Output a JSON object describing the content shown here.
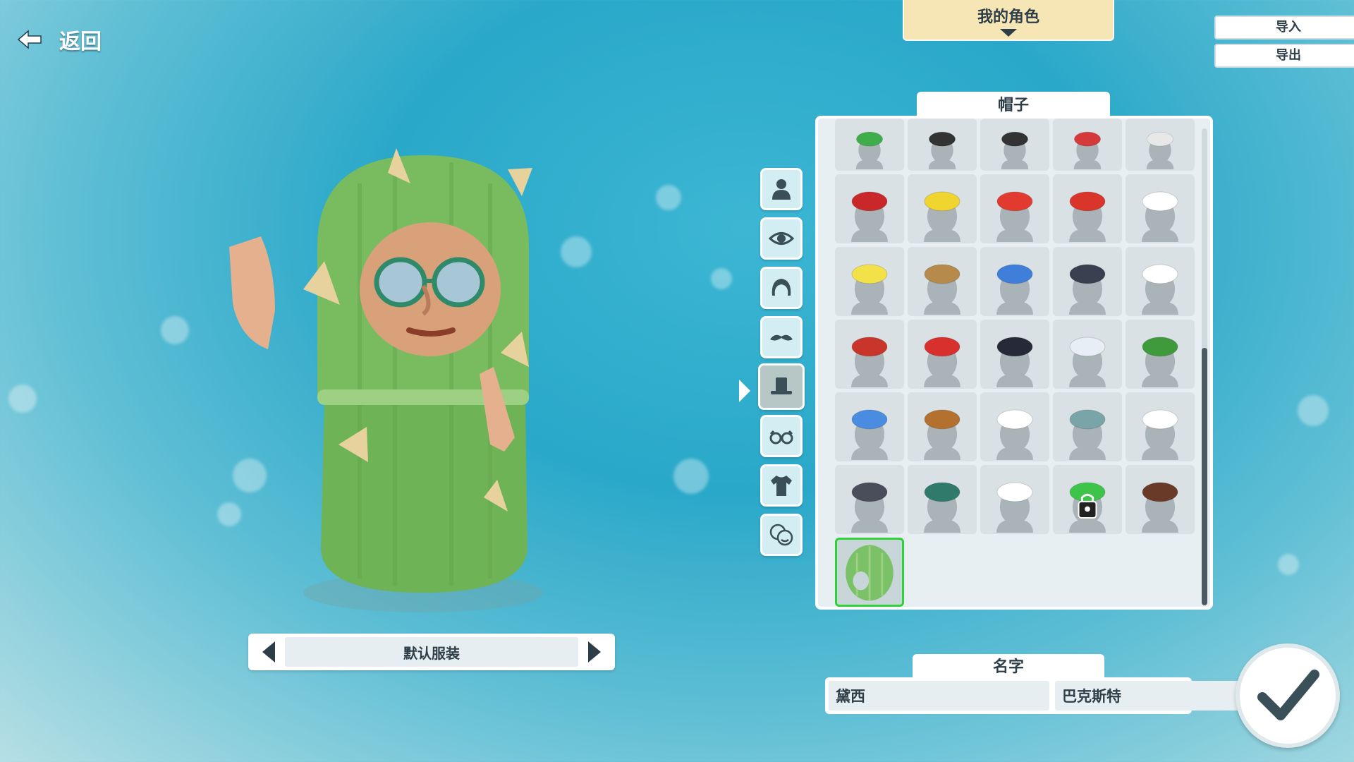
{
  "nav": {
    "back_label": "返回"
  },
  "top_tab": {
    "label": "我的角色"
  },
  "io": {
    "import_label": "导入",
    "export_label": "导出"
  },
  "outfit": {
    "name": "默认服装"
  },
  "categories": [
    {
      "icon": "body-icon",
      "active": false
    },
    {
      "icon": "eye-icon",
      "active": false
    },
    {
      "icon": "hair-icon",
      "active": false
    },
    {
      "icon": "mustache-icon",
      "active": false
    },
    {
      "icon": "top-hat-icon",
      "active": true
    },
    {
      "icon": "glasses-icon",
      "active": false
    },
    {
      "icon": "shirt-icon",
      "active": false
    },
    {
      "icon": "emote-icon",
      "active": false
    }
  ],
  "hats": {
    "title": "帽子",
    "items": [
      {
        "id": "hat-green-cap",
        "color": "#3fae4a",
        "locked": false
      },
      {
        "id": "hat-black-cap",
        "color": "#333333",
        "locked": false
      },
      {
        "id": "hat-black-cap-2",
        "color": "#333333",
        "locked": false
      },
      {
        "id": "hat-red-cap",
        "color": "#d43a3a",
        "locked": false
      },
      {
        "id": "hat-white-cap",
        "color": "#e8e8e8",
        "locked": false
      },
      {
        "id": "hat-fez",
        "color": "#c9282a",
        "locked": false
      },
      {
        "id": "hat-party",
        "color": "#f0d430",
        "locked": false
      },
      {
        "id": "hat-dragon",
        "color": "#e23a2e",
        "locked": false
      },
      {
        "id": "hat-lion-dance",
        "color": "#d9352a",
        "locked": false
      },
      {
        "id": "hat-sailor",
        "color": "#ffffff",
        "locked": false
      },
      {
        "id": "hat-flower-crown",
        "color": "#f3e14a",
        "locked": false
      },
      {
        "id": "hat-viking",
        "color": "#b58a4a",
        "locked": false
      },
      {
        "id": "hat-fish",
        "color": "#3f7fd9",
        "locked": false
      },
      {
        "id": "hat-captain",
        "color": "#3a4050",
        "locked": false
      },
      {
        "id": "hat-sun",
        "color": "#ffffff",
        "locked": false
      },
      {
        "id": "hat-spartan",
        "color": "#c9352a",
        "locked": false
      },
      {
        "id": "hat-beret",
        "color": "#d8302c",
        "locked": false
      },
      {
        "id": "hat-bicorne",
        "color": "#262a38",
        "locked": false
      },
      {
        "id": "hat-feather",
        "color": "#e8eef5",
        "locked": false
      },
      {
        "id": "hat-tyrolean",
        "color": "#3e9a3a",
        "locked": false
      },
      {
        "id": "hat-drink-helmet",
        "color": "#4a8de0",
        "locked": false
      },
      {
        "id": "hat-bear",
        "color": "#b4702e",
        "locked": false
      },
      {
        "id": "hat-baseball-white",
        "color": "#ffffff",
        "locked": false
      },
      {
        "id": "hat-visor",
        "color": "#7aa5a8",
        "locked": false
      },
      {
        "id": "hat-white-bowler",
        "color": "#ffffff",
        "locked": false
      },
      {
        "id": "hat-fedora",
        "color": "#4a4e5a",
        "locked": false
      },
      {
        "id": "hat-peacock",
        "color": "#2f7a6a",
        "locked": false
      },
      {
        "id": "hat-eagle",
        "color": "#ffffff",
        "locked": false
      },
      {
        "id": "hat-locked",
        "color": "#3fc44a",
        "locked": true
      },
      {
        "id": "hat-cowboy",
        "color": "#6a3a28",
        "locked": false
      },
      {
        "id": "hat-cactus",
        "color": "#7bc167",
        "locked": false,
        "selected": true
      }
    ]
  },
  "name": {
    "title": "名字",
    "first": "黛西",
    "last": "巴克斯特"
  },
  "confirm": {
    "icon": "checkmark-icon"
  }
}
